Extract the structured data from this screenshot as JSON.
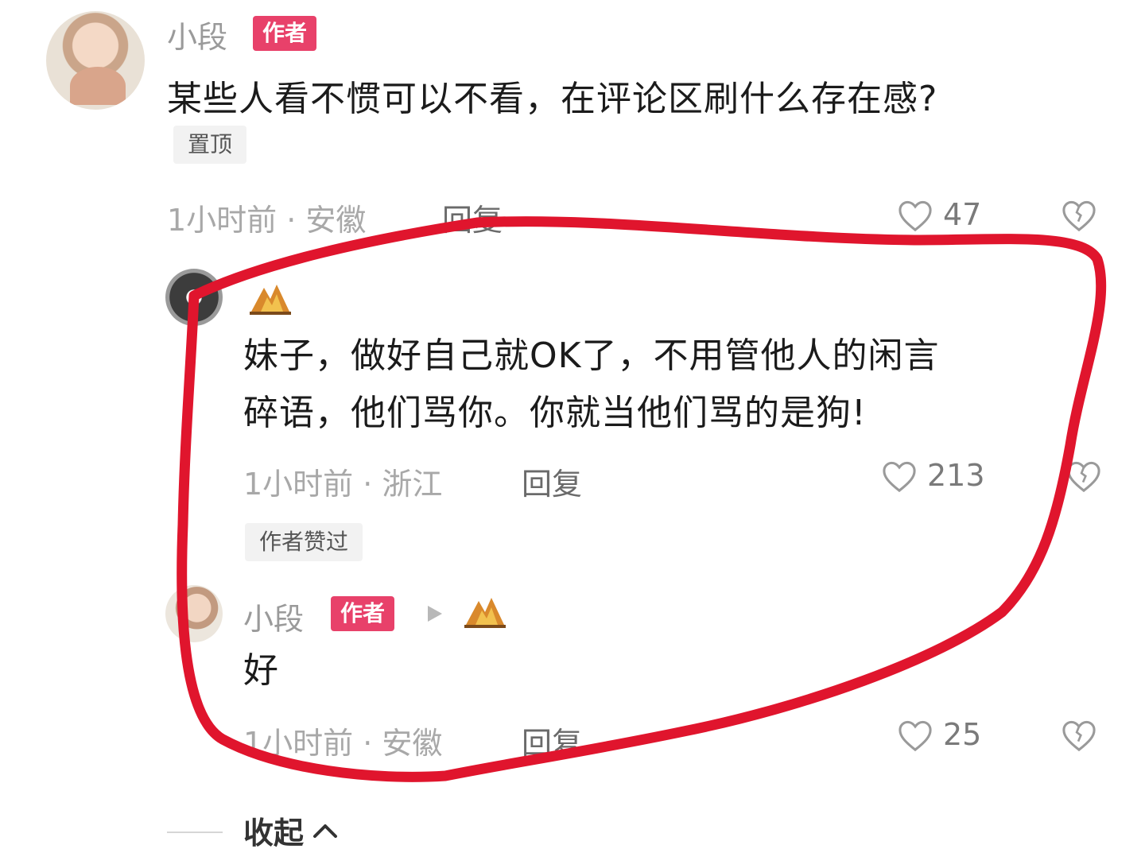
{
  "comment": {
    "username": "小段",
    "author_tag": "作者",
    "text": "某些人看不惯可以不看，在评论区刷什么存在感?",
    "pinned_label": "置顶",
    "meta": "1小时前 · 安徽",
    "reply_label": "回复",
    "likes": "47"
  },
  "replies": [
    {
      "text_line1": "妹子，做好自己就OK了，不用管他人的闲言",
      "text_line2": "碎语，他们骂你。你就当他们骂的是狗!",
      "meta": "1小时前 · 浙江",
      "reply_label": "回复",
      "likes": "213",
      "liked_by_author_label": "作者赞过"
    },
    {
      "username": "小段",
      "author_tag": "作者",
      "text": "好",
      "meta": "1小时前 · 安徽",
      "reply_label": "回复",
      "likes": "25"
    }
  ],
  "collapse_label": "收起",
  "colors": {
    "author_tag": "#e8416a",
    "annotation_stroke": "#e0152d"
  },
  "icons": {
    "like": "heart-outline-icon",
    "dislike": "broken-heart-icon",
    "badge": "fire-badge-icon",
    "reply_arrow": "play-triangle-icon",
    "collapse": "chevron-up-icon"
  }
}
